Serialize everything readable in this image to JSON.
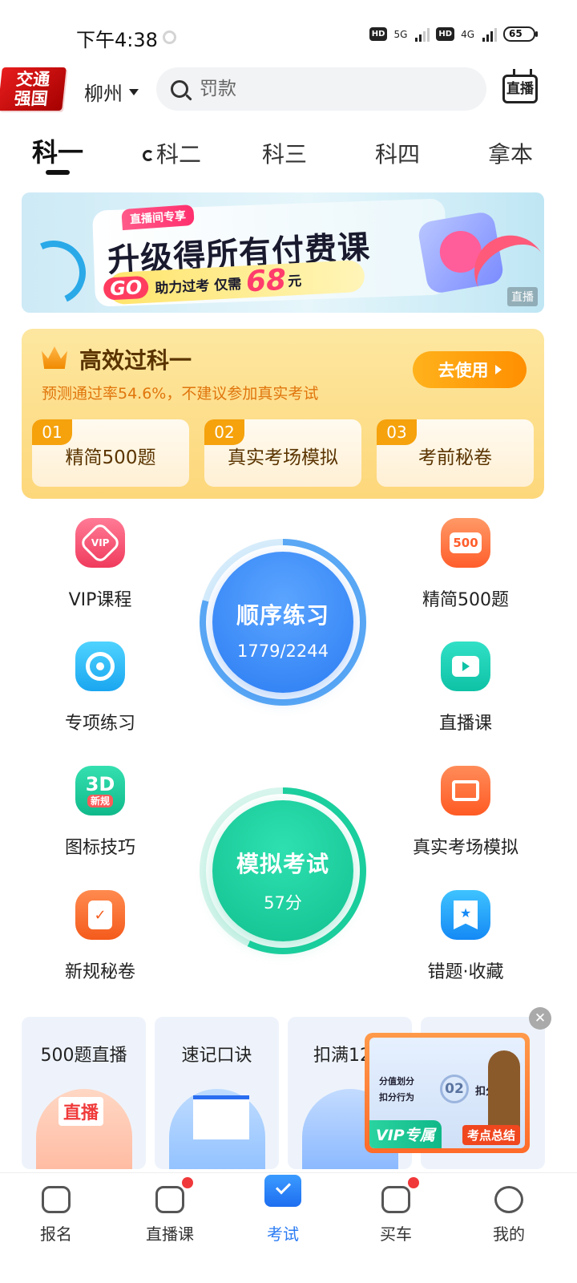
{
  "status_bar": {
    "time": "下午4:38",
    "hd1": "HD",
    "net1": "5G",
    "hd2": "HD",
    "net2": "4G",
    "battery": "65"
  },
  "header": {
    "logo_line1": "交通",
    "logo_line2": "强国",
    "city": "柳州",
    "search_placeholder": "罚款",
    "live_button": "直播"
  },
  "tabs": [
    {
      "label": "科一",
      "active": true
    },
    {
      "label": "科二",
      "active": false,
      "live": true
    },
    {
      "label": "科三",
      "active": false
    },
    {
      "label": "科四",
      "active": false
    },
    {
      "label": "拿本",
      "active": false
    }
  ],
  "banner": {
    "tag": "直播间专享",
    "title": "升级得所有付费课",
    "go": "GO",
    "sub": "助力过考 仅需",
    "price": "68",
    "unit": "元",
    "badge": "直播"
  },
  "promo": {
    "title": "高效过科一",
    "desc": "预测通过率54.6%，不建议参加真实考试",
    "button": "去使用",
    "items": [
      {
        "num": "01",
        "label": "精简500题"
      },
      {
        "num": "02",
        "label": "真实考场模拟"
      },
      {
        "num": "03",
        "label": "考前秘卷"
      }
    ]
  },
  "grid": {
    "vip": "VIP课程",
    "vip_icon_text": "VIP",
    "t500": "精简500题",
    "t500_icon_text": "500",
    "special": "专项练习",
    "live": "直播课",
    "signs": "图标技巧",
    "signs_badge": "新规",
    "real": "真实考场模拟",
    "secret": "新规秘卷",
    "wrong": "错题·收藏"
  },
  "circles": {
    "order_title": "顺序练习",
    "order_progress": "1779/2244",
    "order_fraction": 0.793,
    "mock_title": "模拟考试",
    "mock_score": "57分",
    "mock_fraction": 0.57
  },
  "cards": [
    {
      "title": "500题直播",
      "art_label": "直播"
    },
    {
      "title": "速记口诀"
    },
    {
      "title": "扣满12"
    }
  ],
  "video": {
    "line1": "分值划分",
    "line2": "扣分行为",
    "num": "02",
    "fen": "扣分分值",
    "vip": "VIP专属",
    "summary": "考点总结"
  },
  "bottom_nav": [
    {
      "label": "报名"
    },
    {
      "label": "直播课",
      "dot": true
    },
    {
      "label": "考试",
      "active": true
    },
    {
      "label": "买车",
      "dot": true
    },
    {
      "label": "我的"
    }
  ],
  "colors": {
    "accent": "#2b7cf3",
    "green": "#12c08f",
    "promo_bg": "#fdd77a",
    "badge_red": "#f0383a"
  }
}
